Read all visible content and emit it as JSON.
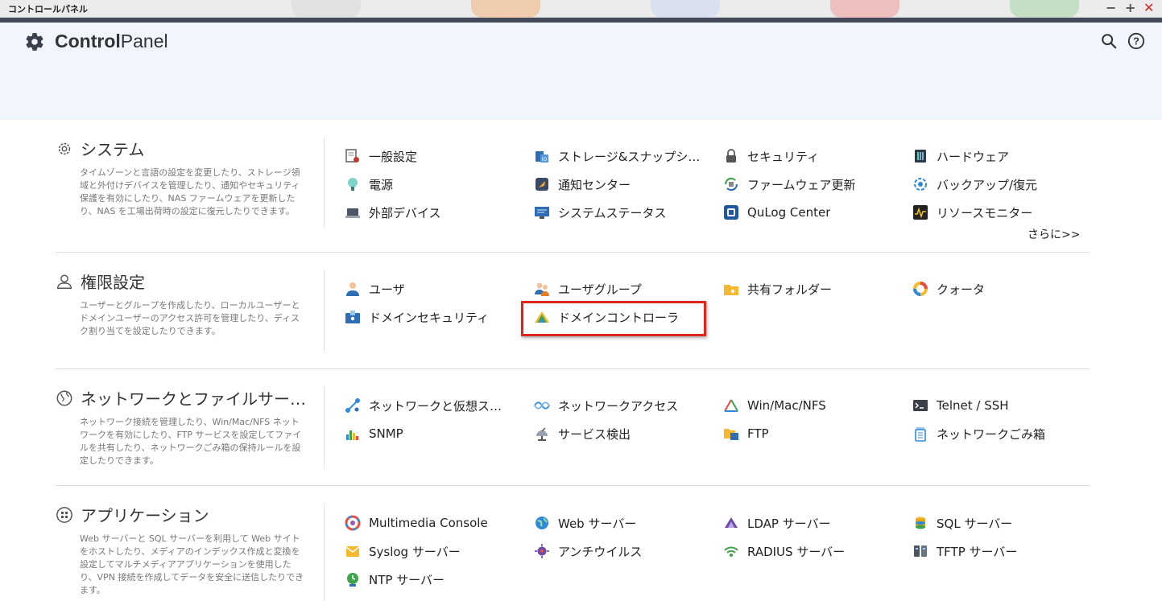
{
  "window": {
    "title": "コントロールパネル"
  },
  "header": {
    "brand_bold": "Control",
    "brand_regular": "Panel"
  },
  "sections": [
    {
      "title": "システム",
      "description": "タイムゾーンと言語の設定を変更したり、ストレージ領域と外付けデバイスを管理したり、通知やセキュリティ保護を有効にしたり、NAS ファームウェアを更新したり、NAS を工場出荷時の設定に復元したりできます。",
      "more": "さらに>>",
      "items": [
        {
          "label": "一般設定",
          "icon": "general-settings-icon"
        },
        {
          "label": "ストレージ&スナップショット総合管理",
          "icon": "storage-snapshots-icon"
        },
        {
          "label": "セキュリティ",
          "icon": "lock-icon"
        },
        {
          "label": "ハードウェア",
          "icon": "hardware-icon"
        },
        {
          "label": "電源",
          "icon": "lightbulb-icon"
        },
        {
          "label": "通知センター",
          "icon": "notification-center-icon"
        },
        {
          "label": "ファームウェア更新",
          "icon": "firmware-update-icon"
        },
        {
          "label": "バックアップ/復元",
          "icon": "backup-restore-icon"
        },
        {
          "label": "外部デバイス",
          "icon": "external-device-icon"
        },
        {
          "label": "システムステータス",
          "icon": "system-status-icon"
        },
        {
          "label": "QuLog Center",
          "icon": "qulog-center-icon"
        },
        {
          "label": "リソースモニター",
          "icon": "resource-monitor-icon"
        }
      ]
    },
    {
      "title": "権限設定",
      "description": "ユーザーとグループを作成したり、ローカルユーザーとドメインユーザーのアクセス許可を管理したり、ディスク割り当てを設定したりできます。",
      "items": [
        {
          "label": "ユーザ",
          "icon": "user-icon"
        },
        {
          "label": "ユーザグループ",
          "icon": "user-group-icon"
        },
        {
          "label": "共有フォルダー",
          "icon": "shared-folder-icon"
        },
        {
          "label": "クォータ",
          "icon": "quota-icon"
        },
        {
          "label": "ドメインセキュリティ",
          "icon": "domain-security-icon"
        },
        {
          "label": "ドメインコントローラ",
          "icon": "domain-controller-icon"
        }
      ]
    },
    {
      "title": "ネットワークとファイルサービス",
      "description": "ネットワーク接続を管理したり、Win/Mac/NFS ネットワークを有効にしたり、FTP サービスを設定してファイルを共有したり、ネットワークごみ箱の保持ルールを設定したりできます。",
      "items": [
        {
          "label": "ネットワークと仮想スイッチ",
          "icon": "network-virtual-switch-icon"
        },
        {
          "label": "ネットワークアクセス",
          "icon": "network-access-icon"
        },
        {
          "label": "Win/Mac/NFS",
          "icon": "win-mac-nfs-icon"
        },
        {
          "label": "Telnet / SSH",
          "icon": "terminal-icon"
        },
        {
          "label": "SNMP",
          "icon": "snmp-icon"
        },
        {
          "label": "サービス検出",
          "icon": "service-discovery-icon"
        },
        {
          "label": "FTP",
          "icon": "ftp-icon"
        },
        {
          "label": "ネットワークごみ箱",
          "icon": "recycle-bin-icon"
        }
      ]
    },
    {
      "title": "アプリケーション",
      "description": "Web サーバーと SQL サーバーを利用して Web サイトをホストしたり、メディアのインデックス作成と変換を設定してマルチメディアアプリケーションを使用したり、VPN 接続を作成してデータを安全に送信したりできます。",
      "items": [
        {
          "label": "Multimedia Console",
          "icon": "multimedia-console-icon"
        },
        {
          "label": "Web サーバー",
          "icon": "globe-icon"
        },
        {
          "label": "LDAP サーバー",
          "icon": "ldap-server-icon"
        },
        {
          "label": "SQL サーバー",
          "icon": "database-icon"
        },
        {
          "label": "Syslog サーバー",
          "icon": "syslog-server-icon"
        },
        {
          "label": "アンチウイルス",
          "icon": "antivirus-icon"
        },
        {
          "label": "RADIUS サーバー",
          "icon": "radius-server-icon"
        },
        {
          "label": "TFTP サーバー",
          "icon": "tftp-server-icon"
        },
        {
          "label": "NTP サーバー",
          "icon": "ntp-server-icon"
        }
      ]
    }
  ]
}
